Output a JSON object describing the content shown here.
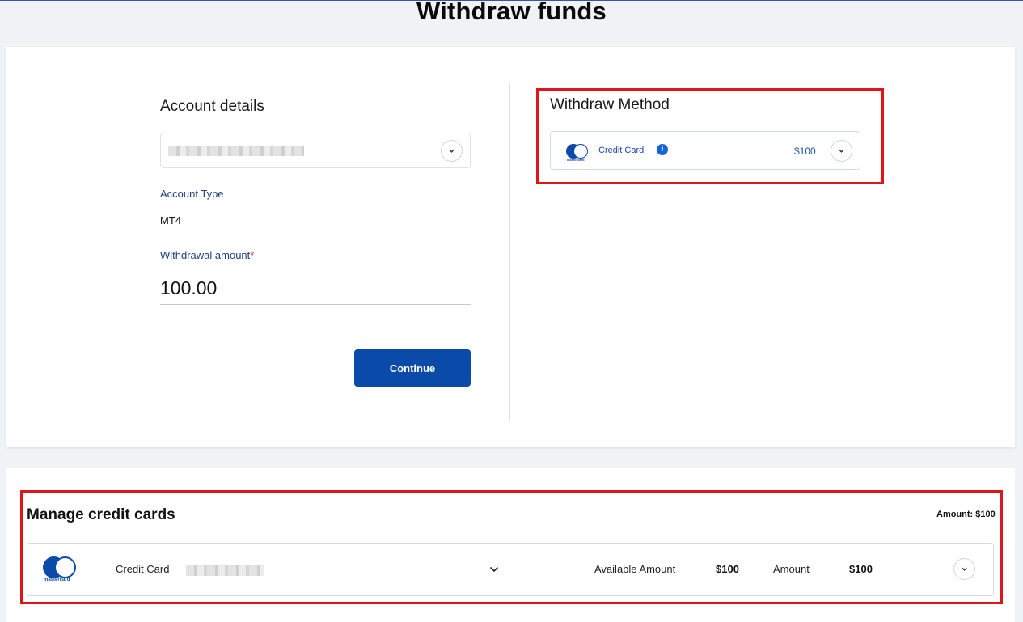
{
  "page": {
    "title": "Withdraw funds"
  },
  "account": {
    "section_title": "Account details",
    "account_type_label": "Account Type",
    "account_type_value": "MT4",
    "withdrawal_amount_label": "Withdrawal amount",
    "required_marker": "*",
    "withdrawal_amount_value": "100.00",
    "continue_label": "Continue"
  },
  "withdraw_method": {
    "section_title": "Withdraw Method",
    "method_name": "Credit Card",
    "method_amount": "$100",
    "logo_text": "mastercard",
    "info_glyph": "i"
  },
  "manage_cards": {
    "section_title": "Manage credit cards",
    "total_amount": "Amount: $100",
    "logo_text": "mastercard",
    "card_label": "Credit Card",
    "available_amount_label": "Available Amount",
    "available_amount_value": "$100",
    "amount_label": "Amount",
    "amount_value": "$100"
  },
  "colors": {
    "primary": "#0a4aa8",
    "label_blue": "#1e3f80",
    "highlight_red": "#e0151a",
    "background": "#f1f2f5"
  },
  "icons": [
    "chevron-down-icon",
    "info-icon",
    "mastercard-logo"
  ]
}
